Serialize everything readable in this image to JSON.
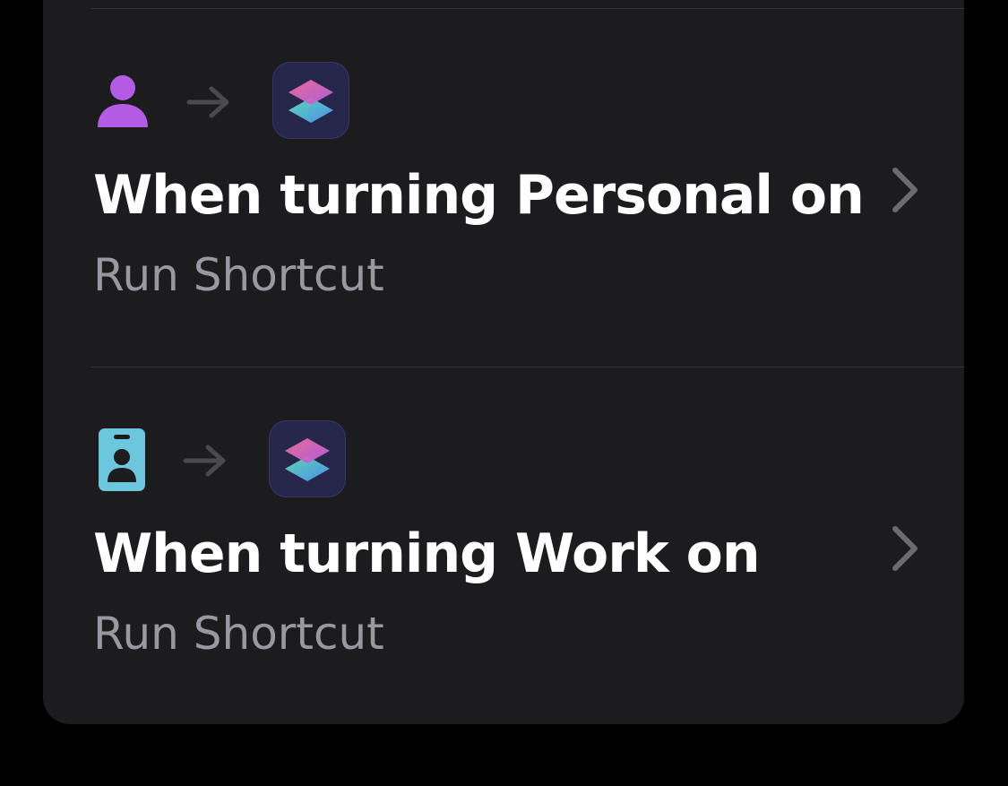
{
  "automations": [
    {
      "trigger_icon": "person-icon",
      "trigger_color": "#b45be6",
      "action_icon": "shortcuts-app-icon",
      "title": "When turning Personal on",
      "subtitle": "Run Shortcut"
    },
    {
      "trigger_icon": "id-badge-icon",
      "trigger_color": "#6cc7de",
      "action_icon": "shortcuts-app-icon",
      "title": "When turning Work on",
      "subtitle": "Run Shortcut"
    }
  ],
  "colors": {
    "background": "#000000",
    "card": "#1c1c1e",
    "title": "#ffffff",
    "subtitle": "#98989f",
    "chevron": "#6b6b70",
    "arrow": "#4a4a4e"
  }
}
